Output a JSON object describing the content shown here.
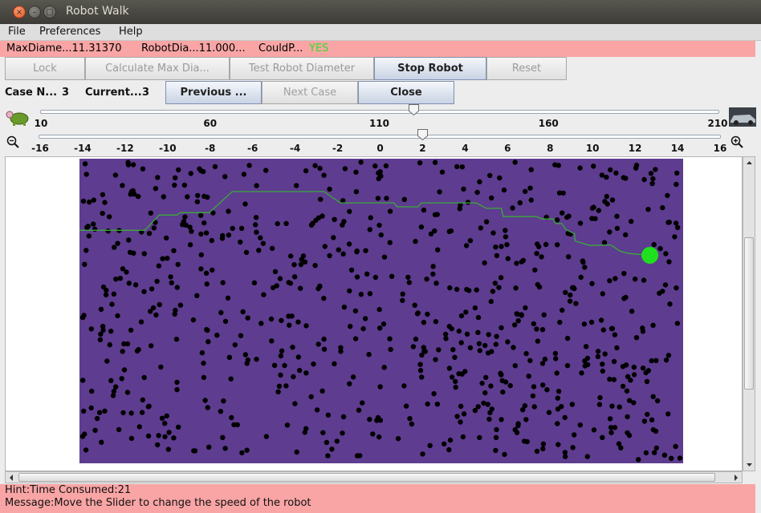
{
  "window": {
    "title": "Robot Walk"
  },
  "menu": [
    "File",
    "Preferences",
    "Help"
  ],
  "info": {
    "max_diameter": "MaxDiame...11.31370",
    "robot_diameter": "RobotDia...11.000...",
    "could_pass_label": "CouldP...",
    "could_pass_value": "YES",
    "could_pass_color": "#29e229"
  },
  "toolbar": {
    "lock": "Lock",
    "calc_max": "Calculate Max Dia...",
    "test_diameter": "Test Robot Diameter",
    "stop_robot": "Stop Robot",
    "reset": "Reset"
  },
  "case_bar": {
    "case_number_label": "Case N...",
    "case_number_value": "3",
    "current_label": "Current...",
    "current_value": "3",
    "previous": "Previous ...",
    "next": "Next Case",
    "close": "Close"
  },
  "speed_slider": {
    "ticks": [
      "10",
      "60",
      "110",
      "160",
      "210"
    ],
    "min": 10,
    "max": 210,
    "value": 120,
    "left_icon": "turtle-icon",
    "right_icon": "car-icon"
  },
  "zoom_slider": {
    "ticks": [
      "-16",
      "-14",
      "-12",
      "-10",
      "-8",
      "-6",
      "-4",
      "-2",
      "0",
      "2",
      "4",
      "6",
      "8",
      "10",
      "12",
      "14",
      "16"
    ],
    "min": -16,
    "max": 16,
    "value": 2,
    "left_icon": "zoom-out-icon",
    "right_icon": "zoom-in-icon"
  },
  "field": {
    "background": "#5e3c8f",
    "obstacle_color": "#000000",
    "path_color": "#3aaa3a",
    "robot_color": "#1fe01f",
    "path": [
      [
        0,
        0.235
      ],
      [
        0.108,
        0.235
      ],
      [
        0.132,
        0.185
      ],
      [
        0.161,
        0.185
      ],
      [
        0.167,
        0.177
      ],
      [
        0.215,
        0.177
      ],
      [
        0.253,
        0.108
      ],
      [
        0.405,
        0.108
      ],
      [
        0.432,
        0.145
      ],
      [
        0.521,
        0.145
      ],
      [
        0.526,
        0.158
      ],
      [
        0.561,
        0.158
      ],
      [
        0.566,
        0.145
      ],
      [
        0.657,
        0.145
      ],
      [
        0.674,
        0.163
      ],
      [
        0.699,
        0.163
      ],
      [
        0.702,
        0.19
      ],
      [
        0.757,
        0.19
      ],
      [
        0.766,
        0.198
      ],
      [
        0.785,
        0.198
      ],
      [
        0.789,
        0.213
      ],
      [
        0.799,
        0.213
      ],
      [
        0.806,
        0.233
      ],
      [
        0.82,
        0.246
      ],
      [
        0.821,
        0.27
      ],
      [
        0.846,
        0.285
      ],
      [
        0.88,
        0.283
      ],
      [
        0.895,
        0.303
      ],
      [
        0.91,
        0.311
      ],
      [
        0.944,
        0.317
      ]
    ],
    "robot": [
      0.945,
      0.317
    ]
  },
  "status": {
    "hint": "Hint:Time Consumed:21",
    "message": "Message:Move the Slider to change the speed of the robot"
  }
}
